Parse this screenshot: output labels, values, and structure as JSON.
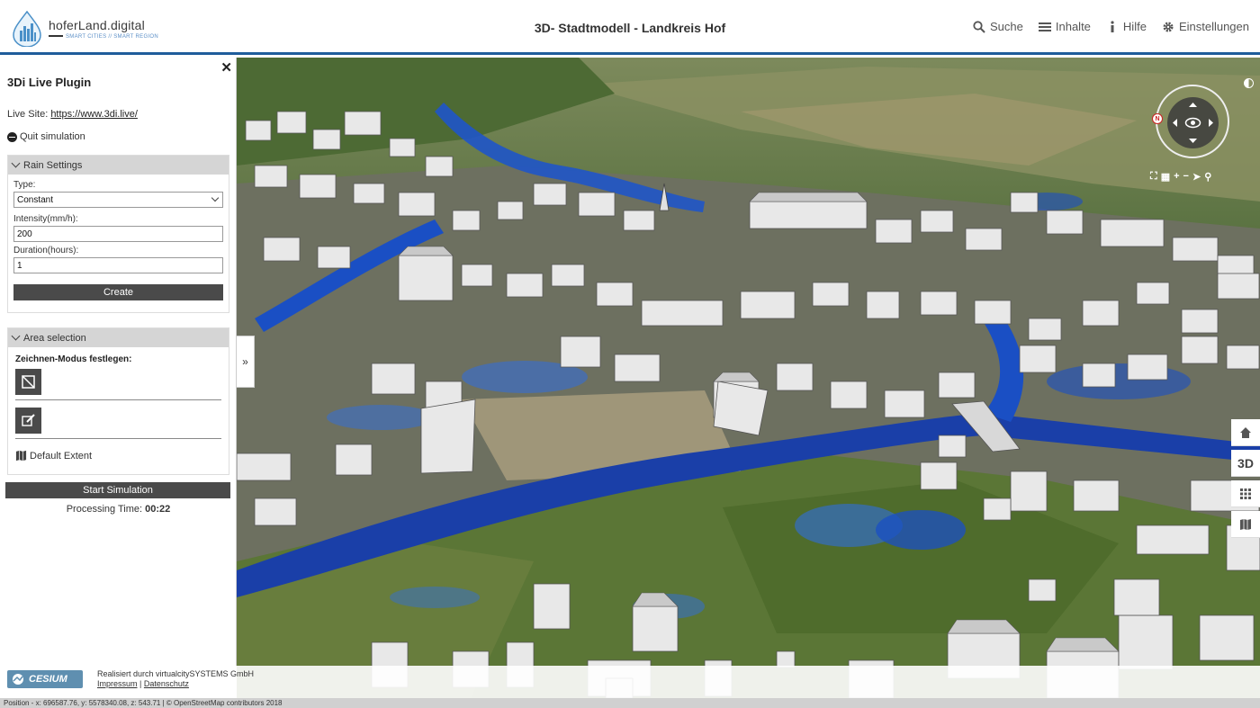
{
  "header": {
    "logo_title": "hoferLand.digital",
    "logo_subtitle": "SMART CITIES // SMART REGION",
    "title": "3D- Stadtmodell - Landkreis Hof",
    "nav": [
      {
        "label": "Suche",
        "icon": "search-icon"
      },
      {
        "label": "Inhalte",
        "icon": "menu-icon"
      },
      {
        "label": "Hilfe",
        "icon": "info-icon"
      },
      {
        "label": "Einstellungen",
        "icon": "gear-icon"
      }
    ]
  },
  "sidebar": {
    "title": "3Di Live Plugin",
    "live_site_label": "Live Site:",
    "live_site_url": "https://www.3di.live/",
    "quit_label": "Quit simulation",
    "rain_settings": {
      "header": "Rain Settings",
      "type_label": "Type:",
      "type_value": "Constant",
      "intensity_label": "Intensity(mm/h):",
      "intensity_value": "200",
      "duration_label": "Duration(hours):",
      "duration_value": "1",
      "create_label": "Create"
    },
    "area_selection": {
      "header": "Area selection",
      "draw_mode_label": "Zeichnen-Modus festlegen:",
      "default_extent_label": "Default Extent"
    },
    "start_label": "Start Simulation",
    "processing_label": "Processing Time:",
    "processing_value": "00:22"
  },
  "map_controls": {
    "north_label": "N",
    "right_buttons": [
      "home-icon",
      "3D",
      "grid-icon",
      "map-icon"
    ],
    "three_d_label": "3D"
  },
  "footer": {
    "cesium_label": "CESIUM",
    "credit_line": "Realisiert durch virtualcitySYSTEMS GmbH",
    "impressum": "Impressum",
    "separator": "|",
    "datenschutz": "Datenschutz",
    "status": "Position - x: 696587.76, y: 5578340.08, z: 543.71 | © OpenStreetMap contributors 2018"
  },
  "colors": {
    "accent": "#1f5d9b",
    "button_dark": "#4a4a4a",
    "panel_header": "#d5d5d5",
    "flood_water": "#1a4fc4"
  }
}
